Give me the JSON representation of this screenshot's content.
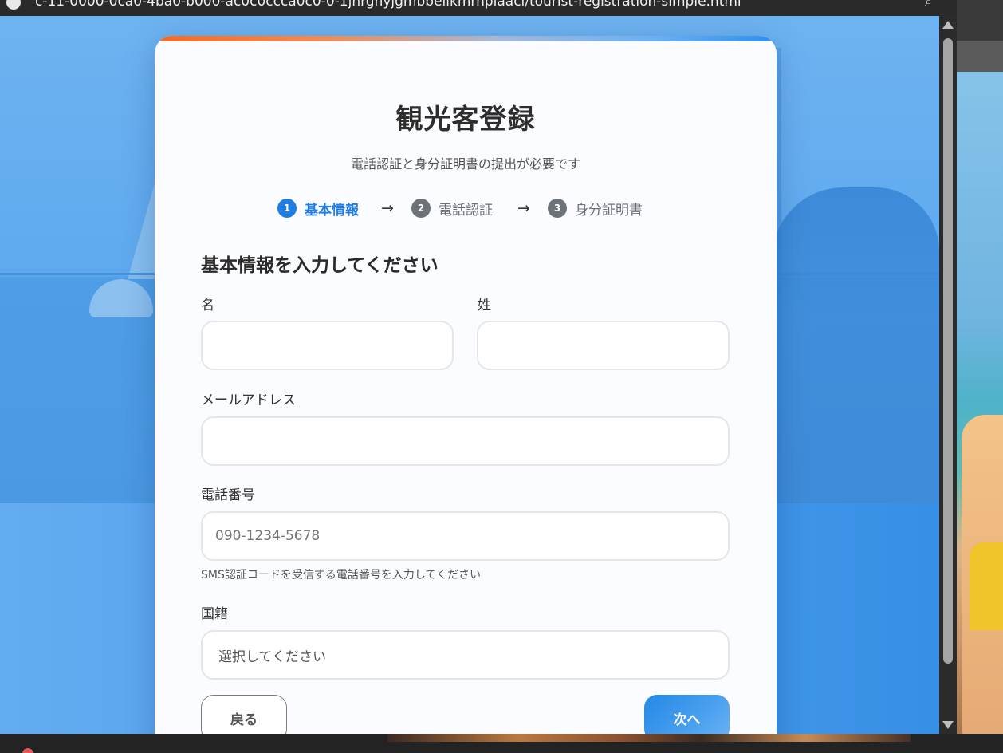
{
  "browser": {
    "url_fragment": "c-11-0000-0ca0-4ba0-b000-ac0c0ccca0c0-0-1jhrgnyjgmbbeilkmrhplaacl/tourist-registration-simple.html"
  },
  "page": {
    "title": "観光客登録",
    "subtitle": "電話認証と身分証明書の提出が必要です"
  },
  "steps": [
    {
      "num": "1",
      "label": "基本情報",
      "active": true
    },
    {
      "num": "2",
      "label": "電話認証",
      "active": false
    },
    {
      "num": "3",
      "label": "身分証明書",
      "active": false
    }
  ],
  "step_arrow": "→",
  "form": {
    "section_title": "基本情報を入力してください",
    "first_name": {
      "label": "名",
      "value": ""
    },
    "last_name": {
      "label": "姓",
      "value": ""
    },
    "email": {
      "label": "メールアドレス",
      "value": ""
    },
    "phone": {
      "label": "電話番号",
      "placeholder": "090-1234-5678",
      "help": "SMS認証コードを受信する電話番号を入力してください"
    },
    "nationality": {
      "label": "国籍",
      "selected": "選択してください"
    }
  },
  "buttons": {
    "back": "戻る",
    "next": "次へ"
  },
  "colors": {
    "accent": "#1f7de4",
    "inactive_step": "#6d7279",
    "background_blue": "#4c9ded"
  }
}
